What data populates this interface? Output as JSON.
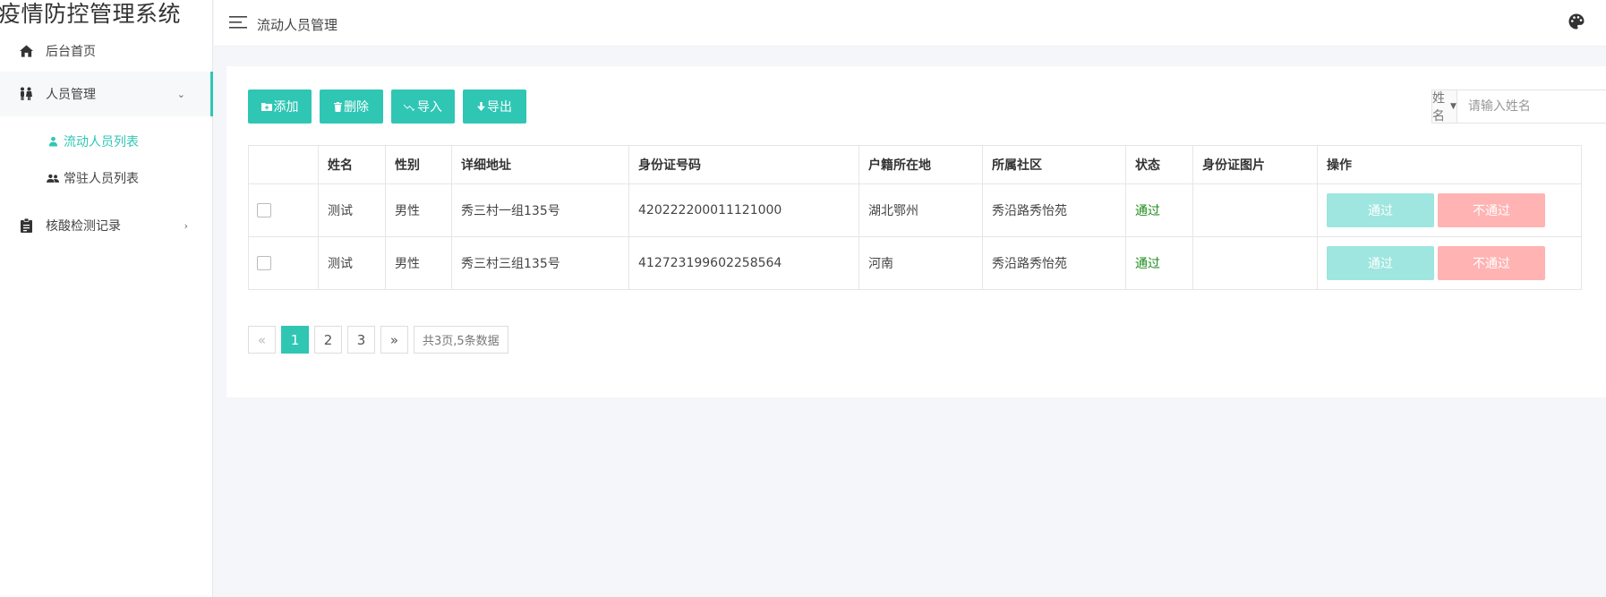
{
  "app": {
    "title": "疫情防控管理系统"
  },
  "sidebar": {
    "items": [
      {
        "label": "后台首页",
        "icon": "home-icon"
      },
      {
        "label": "人员管理",
        "icon": "people-icon",
        "expanded": true,
        "children": [
          {
            "label": "流动人员列表",
            "icon": "person-icon",
            "active": true
          },
          {
            "label": "常驻人员列表",
            "icon": "group-icon",
            "active": false
          }
        ]
      },
      {
        "label": "核酸检测记录",
        "icon": "clipboard-icon",
        "expanded": false
      }
    ]
  },
  "header": {
    "title": "流动人员管理",
    "menu_icon": "menu-icon",
    "theme_icon": "palette-icon"
  },
  "toolbar": {
    "add": "添加",
    "delete": "删除",
    "import": "导入",
    "export": "导出"
  },
  "search": {
    "field": "姓名",
    "placeholder": "请输入姓名"
  },
  "table": {
    "columns": [
      "姓名",
      "性别",
      "详细地址",
      "身份证号码",
      "户籍所在地",
      "所属社区",
      "状态",
      "身份证图片",
      "操作"
    ],
    "rows": [
      {
        "name": "测试",
        "gender": "男性",
        "address": "秀三村一组135号",
        "id_number": "420222200011121000",
        "hometown": "湖北鄂州",
        "community": "秀沿路秀怡苑",
        "status": "通过",
        "id_image": "",
        "pass": "通过",
        "reject": "不通过"
      },
      {
        "name": "测试",
        "gender": "男性",
        "address": "秀三村三组135号",
        "id_number": "412723199602258564",
        "hometown": "河南",
        "community": "秀沿路秀怡苑",
        "status": "通过",
        "id_image": "",
        "pass": "通过",
        "reject": "不通过"
      }
    ]
  },
  "pagination": {
    "prev": "«",
    "pages": [
      "1",
      "2",
      "3"
    ],
    "current": "1",
    "next": "»",
    "info": "共3页,5条数据"
  },
  "colors": {
    "accent": "#2fc6b4",
    "pass_button": "#9ee6df",
    "reject_button": "#ffb3b3",
    "status_ok": "#1c8c1c"
  }
}
